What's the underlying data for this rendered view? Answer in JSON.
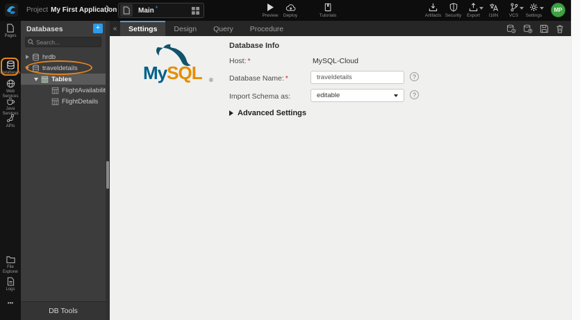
{
  "topbar": {
    "project_label": "Project",
    "project_name": "My First Application",
    "page_tab": {
      "name": "Main",
      "modified_indicator": "*"
    },
    "actions": {
      "preview": "Preview",
      "deploy": "Deploy",
      "tutorials": "Tutorials"
    },
    "tools": {
      "artifacts": "Artifacts",
      "security": "Security",
      "export": "Export",
      "i18n": "I18N",
      "vcs": "VCS",
      "settings": "Settings"
    },
    "avatar_initials": "MP"
  },
  "rail": {
    "pages": "Pages",
    "databases": "Databases",
    "web_services": "Web Services",
    "java_services": "Java Services",
    "apis": "APIs",
    "file_explorer": "File Explorer",
    "logs": "Logs",
    "more": "•••"
  },
  "panel": {
    "title": "Databases",
    "search_placeholder": "Search...",
    "tree": {
      "db1": "hrdb",
      "db2": "traveldetails",
      "tables_group": "Tables",
      "table1": "FlightAvailability",
      "table2": "FlightDetails"
    },
    "footer": "DB Tools"
  },
  "tabs": {
    "settings": "Settings",
    "design": "Design",
    "query": "Query",
    "procedure": "Procedure"
  },
  "form": {
    "heading": "Database Info",
    "required_marker": "*",
    "host_label": "Host:",
    "host_value": "MySQL-Cloud",
    "dbname_label": "Database Name:",
    "dbname_value": "traveldetails",
    "import_label": "Import Schema as:",
    "import_value": "editable",
    "advanced_label": "Advanced Settings",
    "help_glyph": "?"
  },
  "logo": {
    "mysql_my": "My",
    "mysql_sql": "SQL",
    "reg": "®"
  },
  "colors": {
    "accent_blue": "#2e9be6",
    "annotation_orange": "#e8851d",
    "avatar_green": "#3fa142",
    "tab_active_border": "#4f9bd8",
    "mysql_blue": "#00618a",
    "mysql_orange": "#e48e00",
    "required_red": "#cc2222"
  }
}
